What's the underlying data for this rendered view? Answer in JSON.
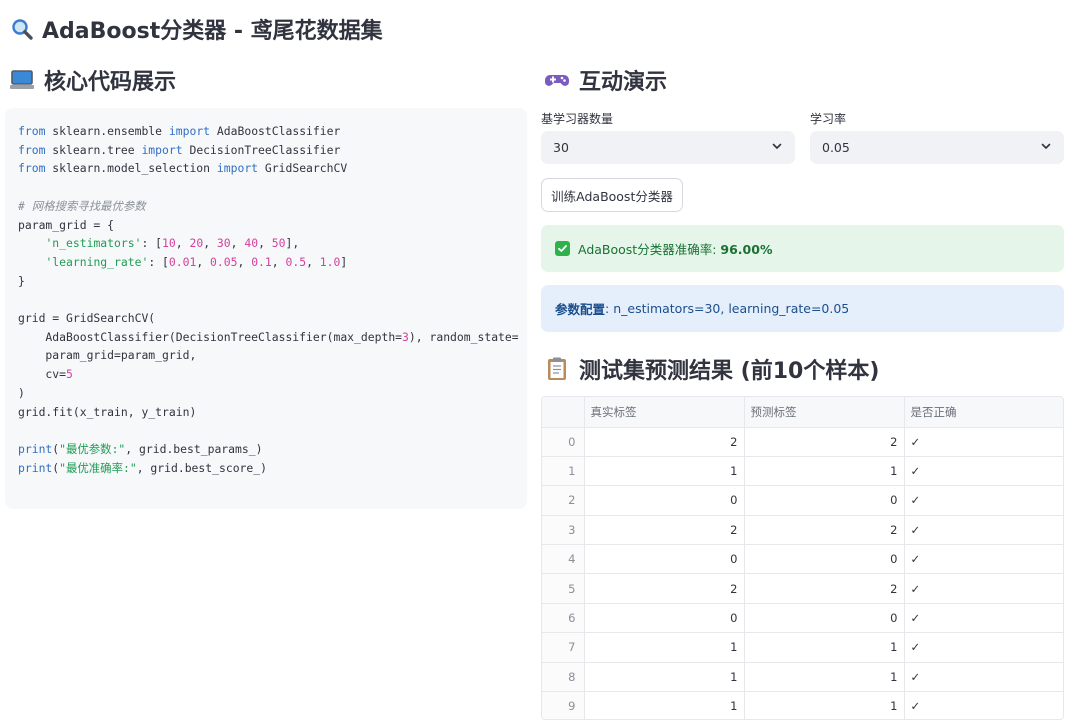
{
  "page": {
    "title": "AdaBoost分类器 - 鸢尾花数据集"
  },
  "left": {
    "title": "核心代码展示"
  },
  "right": {
    "title": "互动演示",
    "n_estimators": {
      "label": "基学习器数量",
      "value": "30"
    },
    "learning_rate": {
      "label": "学习率",
      "value": "0.05"
    },
    "train_button": "训练AdaBoost分类器",
    "success_prefix": "AdaBoost分类器准确率: ",
    "success_value": "96.00%",
    "info_label": "参数配置",
    "info_text": ": n_estimators=30, learning_rate=0.05",
    "results_title": "测试集预测结果 (前10个样本)"
  },
  "table": {
    "columns": [
      "",
      "真实标签",
      "预测标签",
      "是否正确"
    ],
    "rows": [
      {
        "idx": "0",
        "true": "2",
        "pred": "2",
        "ok": "✓"
      },
      {
        "idx": "1",
        "true": "1",
        "pred": "1",
        "ok": "✓"
      },
      {
        "idx": "2",
        "true": "0",
        "pred": "0",
        "ok": "✓"
      },
      {
        "idx": "3",
        "true": "2",
        "pred": "2",
        "ok": "✓"
      },
      {
        "idx": "4",
        "true": "0",
        "pred": "0",
        "ok": "✓"
      },
      {
        "idx": "5",
        "true": "2",
        "pred": "2",
        "ok": "✓"
      },
      {
        "idx": "6",
        "true": "0",
        "pred": "0",
        "ok": "✓"
      },
      {
        "idx": "7",
        "true": "1",
        "pred": "1",
        "ok": "✓"
      },
      {
        "idx": "8",
        "true": "1",
        "pred": "1",
        "ok": "✓"
      },
      {
        "idx": "9",
        "true": "1",
        "pred": "1",
        "ok": "✓"
      }
    ]
  },
  "code": {
    "lines": [
      [
        [
          "kw",
          "from"
        ],
        [
          "t",
          " sklearn.ensemble "
        ],
        [
          "kw",
          "import"
        ],
        [
          "t",
          " AdaBoostClassifier"
        ]
      ],
      [
        [
          "kw",
          "from"
        ],
        [
          "t",
          " sklearn.tree "
        ],
        [
          "kw",
          "import"
        ],
        [
          "t",
          " DecisionTreeClassifier"
        ]
      ],
      [
        [
          "kw",
          "from"
        ],
        [
          "t",
          " sklearn.model_selection "
        ],
        [
          "kw",
          "import"
        ],
        [
          "t",
          " GridSearchCV"
        ]
      ],
      [],
      [
        [
          "cm",
          "# 网格搜索寻找最优参数"
        ]
      ],
      [
        [
          "t",
          "param_grid = {"
        ]
      ],
      [
        [
          "t",
          "    "
        ],
        [
          "str",
          "'n_estimators'"
        ],
        [
          "t",
          ": ["
        ],
        [
          "num",
          "10"
        ],
        [
          "t",
          ", "
        ],
        [
          "num",
          "20"
        ],
        [
          "t",
          ", "
        ],
        [
          "num",
          "30"
        ],
        [
          "t",
          ", "
        ],
        [
          "num",
          "40"
        ],
        [
          "t",
          ", "
        ],
        [
          "num",
          "50"
        ],
        [
          "t",
          "],"
        ]
      ],
      [
        [
          "t",
          "    "
        ],
        [
          "str",
          "'learning_rate'"
        ],
        [
          "t",
          ": ["
        ],
        [
          "num",
          "0.01"
        ],
        [
          "t",
          ", "
        ],
        [
          "num",
          "0.05"
        ],
        [
          "t",
          ", "
        ],
        [
          "num",
          "0.1"
        ],
        [
          "t",
          ", "
        ],
        [
          "num",
          "0.5"
        ],
        [
          "t",
          ", "
        ],
        [
          "num",
          "1.0"
        ],
        [
          "t",
          "]"
        ]
      ],
      [
        [
          "t",
          "}"
        ]
      ],
      [],
      [
        [
          "t",
          "grid = GridSearchCV("
        ]
      ],
      [
        [
          "t",
          "    AdaBoostClassifier(DecisionTreeClassifier(max_depth="
        ],
        [
          "num",
          "3"
        ],
        [
          "t",
          "), random_state="
        ]
      ],
      [
        [
          "t",
          "    param_grid=param_grid,"
        ]
      ],
      [
        [
          "t",
          "    cv="
        ],
        [
          "num",
          "5"
        ]
      ],
      [
        [
          "t",
          ")"
        ]
      ],
      [
        [
          "t",
          "grid.fit(x_train, y_train)"
        ]
      ],
      [],
      [
        [
          "kw",
          "print"
        ],
        [
          "t",
          "("
        ],
        [
          "str",
          "\"最优参数:\""
        ],
        [
          "t",
          ", grid.best_params_)"
        ]
      ],
      [
        [
          "kw",
          "print"
        ],
        [
          "t",
          "("
        ],
        [
          "str",
          "\"最优准确率:\""
        ],
        [
          "t",
          ", grid.best_score_)"
        ]
      ]
    ]
  },
  "icons": {
    "title": "magnifier-icon",
    "code_section": "laptop-icon",
    "demo_section": "gamepad-icon",
    "results_section": "clipboard-icon"
  },
  "colors": {
    "success_bg": "#e6f5ea",
    "success_text": "#177233",
    "info_bg": "#e5effb",
    "info_text": "#1c4f8e",
    "code_bg": "#f7f8fa"
  }
}
